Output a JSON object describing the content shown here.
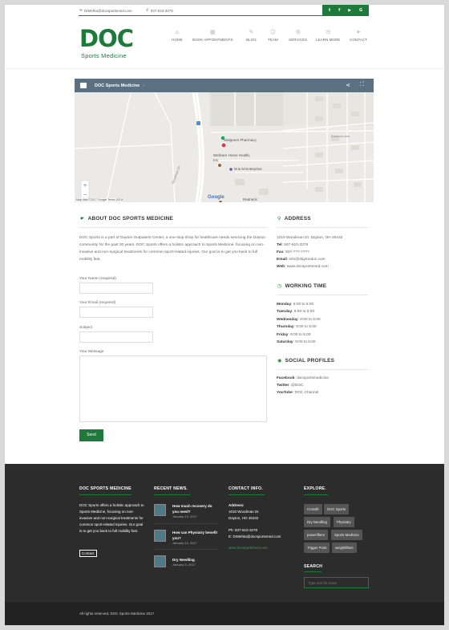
{
  "topbar": {
    "email": "DrMehta@docsportsmed.com",
    "phone": "937-610-3278",
    "social": [
      "t",
      "f",
      "▶",
      "G"
    ]
  },
  "logo": {
    "main": "DOC",
    "sub": "Sports Medicine"
  },
  "nav": [
    {
      "label": "HOME",
      "icon": "⌂"
    },
    {
      "label": "BOOK APPOINTMENTS",
      "icon": "▦"
    },
    {
      "label": "BLOG",
      "icon": "✎"
    },
    {
      "label": "TEAM",
      "icon": "☺"
    },
    {
      "label": "SERVICES",
      "icon": "⚙"
    },
    {
      "label": "LEARN MORE",
      "icon": "✉"
    },
    {
      "label": "CONTACT",
      "icon": "➤"
    }
  ],
  "map": {
    "title": "DOC Sports Medicine",
    "labels": {
      "pharmacy": "Walgreen Pharmacy",
      "wellcare": "Wellcare Home Health, Inc",
      "mm": "M & M Enterprise",
      "redneck": "Redneck",
      "woodman": "Woodman Dr",
      "eastman": "Eastman Ave",
      "google": "Google"
    },
    "attribution": "Map data ©2017 Google   Terms   200 ft"
  },
  "about": {
    "heading": "ABOUT DOC SPORTS MEDICINE",
    "text": "DOC Sports is a part of Dayton Outpatient Center, a one-stop shop for healthcare needs servicing the Dayton community for the past 20 years. DOC Sports offers a holistic approach to Sports Medicine, focusing on non-invasive and non-surgical treatments for common sport-related injuries. Our goal is to get you back to full mobility fast."
  },
  "form": {
    "name_label": "Your Name (required)",
    "email_label": "Your Email (required)",
    "subject_label": "Subject",
    "message_label": "Your Message",
    "send": "Send"
  },
  "address": {
    "heading": "ADDRESS",
    "street": "1010 Woodman Dr. Dayton, OH 45432",
    "tel_label": "Tel",
    "tel": "937-610-3278",
    "fax_label": "Fax",
    "fax": "937-???-????",
    "email_label": "Email",
    "email": "info@daytondoc.com",
    "web_label": "Web",
    "web": "www.docsportsmed.com"
  },
  "working": {
    "heading": "WORKING TIME",
    "days": [
      {
        "day": "Monday",
        "hours": "9:00 to 5:00"
      },
      {
        "day": "Tuesday",
        "hours": "9:00 to 5:00"
      },
      {
        "day": "Wednesday",
        "hours": "9:00 to 5:00"
      },
      {
        "day": "Thursday",
        "hours": "9:00 to 5:00"
      },
      {
        "day": "Friday",
        "hours": "9:00 to 5:00"
      },
      {
        "day": "Saturday",
        "hours": "9:00 to 5:00"
      }
    ]
  },
  "profiles": {
    "heading": "SOCIAL PROFILES",
    "items": [
      {
        "label": "Facebook",
        "value": "docsportsmedicine"
      },
      {
        "label": "Twitter",
        "value": "@DOC"
      },
      {
        "label": "YouTube",
        "value": "DOC Channel"
      }
    ]
  },
  "footer": {
    "about_heading": "DOC SPORTS MEDICINE",
    "about_text": "DOC Sports offers a holistic approach to Sports Medicine, focusing on non-invasive and non-surgical treatments for common sport-related injuries. Our goal is to get you back to full mobility fast.",
    "contact_btn": "Contact",
    "news_heading": "RECENT NEWS.",
    "posts": [
      {
        "title": "How much recovery do you need?",
        "date": "January 13, 2017"
      },
      {
        "title": "How can Physiatry benefit you?",
        "date": "January 10, 2017"
      },
      {
        "title": "Dry Needling",
        "date": "January 5, 2017"
      }
    ],
    "contact_heading": "CONTACT INFO.",
    "addr_label": "Address:",
    "addr1": "1010 Woodman Dr.",
    "addr2": "Dayton, HO 45432",
    "ph": "Ph: 937-610-3278",
    "em": "E: DrMehta@docsportsmed.com",
    "site": "www.docsportsmed.com",
    "explore_heading": "EXPLORE.",
    "tags": [
      "Crossfit",
      "DOC Sports",
      "Dry Needling",
      "Physiatry",
      "powerlifters",
      "Sports Medicine",
      "Trigger Point",
      "weightlifters"
    ],
    "search_heading": "SEARCH",
    "search_placeholder": "Type and hit Enter",
    "copyright": "All rights reserved, DOC Sports Medicine 2017"
  },
  "colors": {
    "brand": "#1d7a3a",
    "footer": "#2c2c2c",
    "mapbar": "#5b7080"
  }
}
